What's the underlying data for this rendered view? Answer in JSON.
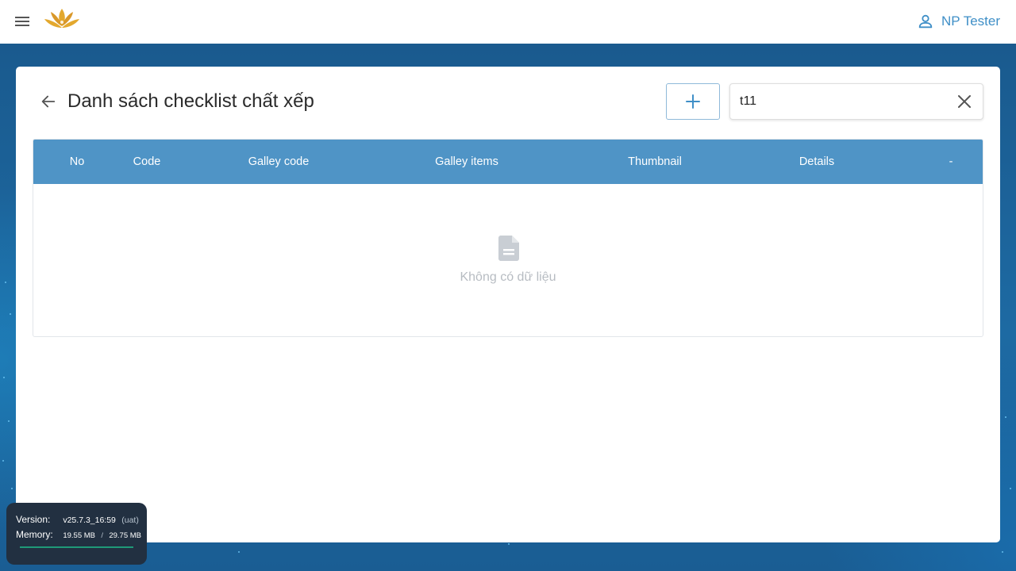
{
  "header": {
    "menu_icon": "hamburger-menu-icon",
    "logo": "lotus-logo",
    "user_name": "NP Tester",
    "user_icon": "person-icon",
    "accent_color": "#3f8fc7"
  },
  "page": {
    "title": "Danh sách checklist chất xếp",
    "back_icon": "arrow-left-icon",
    "add_icon": "plus-icon",
    "search_value": "t11",
    "clear_icon": "close-icon"
  },
  "table": {
    "header_color": "#4f94c6",
    "columns": [
      "No",
      "Code",
      "Galley code",
      "Galley items",
      "Thumbnail",
      "Details",
      "-"
    ],
    "rows": [],
    "empty_icon": "document-icon",
    "empty_text": "Không có dữ liệu"
  },
  "version_panel": {
    "version_label": "Version:",
    "version_value": "v25.7.3_16:59",
    "version_env": "(uat)",
    "memory_label": "Memory:",
    "memory_used": "19.55 MB",
    "memory_sep": "/",
    "memory_total": "29.75 MB"
  }
}
